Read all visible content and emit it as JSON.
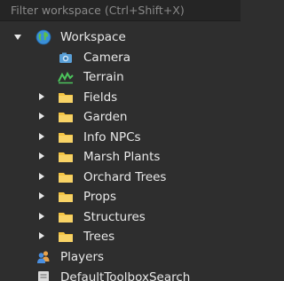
{
  "filter": {
    "placeholder": "Filter workspace (Ctrl+Shift+X)",
    "value": ""
  },
  "workspace": {
    "label": "Workspace",
    "icon": "globe-icon",
    "expanded": true,
    "children": [
      {
        "label": "Camera",
        "icon": "camera-icon",
        "expandable": false
      },
      {
        "label": "Terrain",
        "icon": "terrain-icon",
        "expandable": false
      },
      {
        "label": "Fields",
        "icon": "folder-icon",
        "expandable": true
      },
      {
        "label": "Garden",
        "icon": "folder-icon",
        "expandable": true
      },
      {
        "label": "Info NPCs",
        "icon": "folder-icon",
        "expandable": true
      },
      {
        "label": "Marsh Plants",
        "icon": "folder-icon",
        "expandable": true
      },
      {
        "label": "Orchard Trees",
        "icon": "folder-icon",
        "expandable": true
      },
      {
        "label": "Props",
        "icon": "folder-icon",
        "expandable": true
      },
      {
        "label": "Structures",
        "icon": "folder-icon",
        "expandable": true
      },
      {
        "label": "Trees",
        "icon": "folder-icon",
        "expandable": true
      }
    ]
  },
  "players": {
    "label": "Players",
    "icon": "players-icon"
  },
  "toolbox_search": {
    "label": "DefaultToolboxSearch",
    "icon": "script-icon"
  },
  "colors": {
    "background": "#2e2e2e",
    "filter_background": "#252525",
    "text": "#e8e8e8",
    "folder": "#f5c542"
  }
}
